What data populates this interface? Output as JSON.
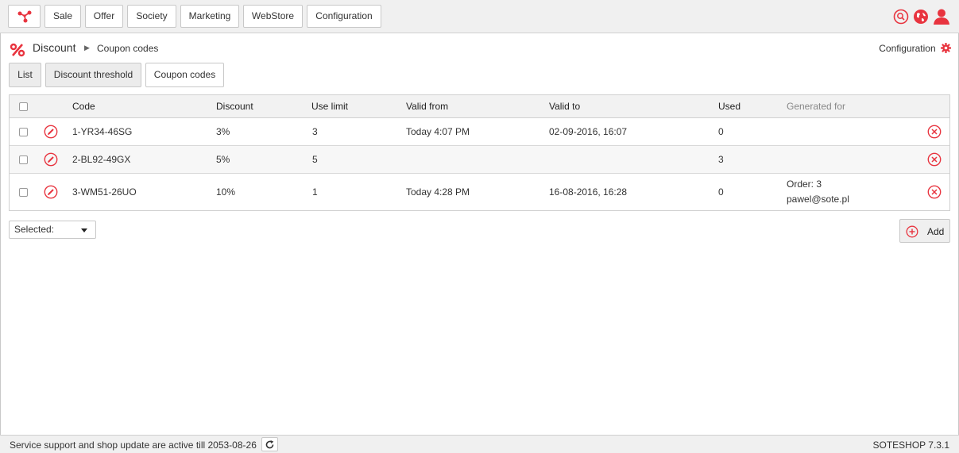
{
  "nav": {
    "items": [
      "Sale",
      "Offer",
      "Society",
      "Marketing",
      "WebStore",
      "Configuration"
    ],
    "icons": [
      "search-icon",
      "globe-icon",
      "user-icon"
    ],
    "accent": "#e8343f"
  },
  "breadcrumb": {
    "main": "Discount",
    "sub": "Coupon codes"
  },
  "config_link": "Configuration",
  "subtabs": [
    {
      "label": "List",
      "active": false
    },
    {
      "label": "Discount threshold",
      "active": false
    },
    {
      "label": "Coupon codes",
      "active": true
    }
  ],
  "table": {
    "headers": {
      "code": "Code",
      "discount": "Discount",
      "use_limit": "Use limit",
      "valid_from": "Valid from",
      "valid_to": "Valid to",
      "used": "Used",
      "generated_for": "Generated for"
    },
    "rows": [
      {
        "code": "1-YR34-46SG",
        "discount": "3%",
        "use_limit": "3",
        "valid_from": "Today 4:07 PM",
        "valid_to": "02-09-2016, 16:07",
        "used": "0",
        "generated_for_1": "",
        "generated_for_2": ""
      },
      {
        "code": "2-BL92-49GX",
        "discount": "5%",
        "use_limit": "5",
        "valid_from": "",
        "valid_to": "",
        "used": "3",
        "generated_for_1": "",
        "generated_for_2": ""
      },
      {
        "code": "3-WM51-26UO",
        "discount": "10%",
        "use_limit": "1",
        "valid_from": "Today 4:28 PM",
        "valid_to": "16-08-2016, 16:28",
        "used": "0",
        "generated_for_1": "Order: 3",
        "generated_for_2": "pawel@sote.pl"
      }
    ]
  },
  "selected_dropdown": "Selected:",
  "add_button": "Add",
  "footer": {
    "support_text": "Service support and shop update are active till 2053-08-26",
    "version": "SOTESHOP 7.3.1"
  }
}
